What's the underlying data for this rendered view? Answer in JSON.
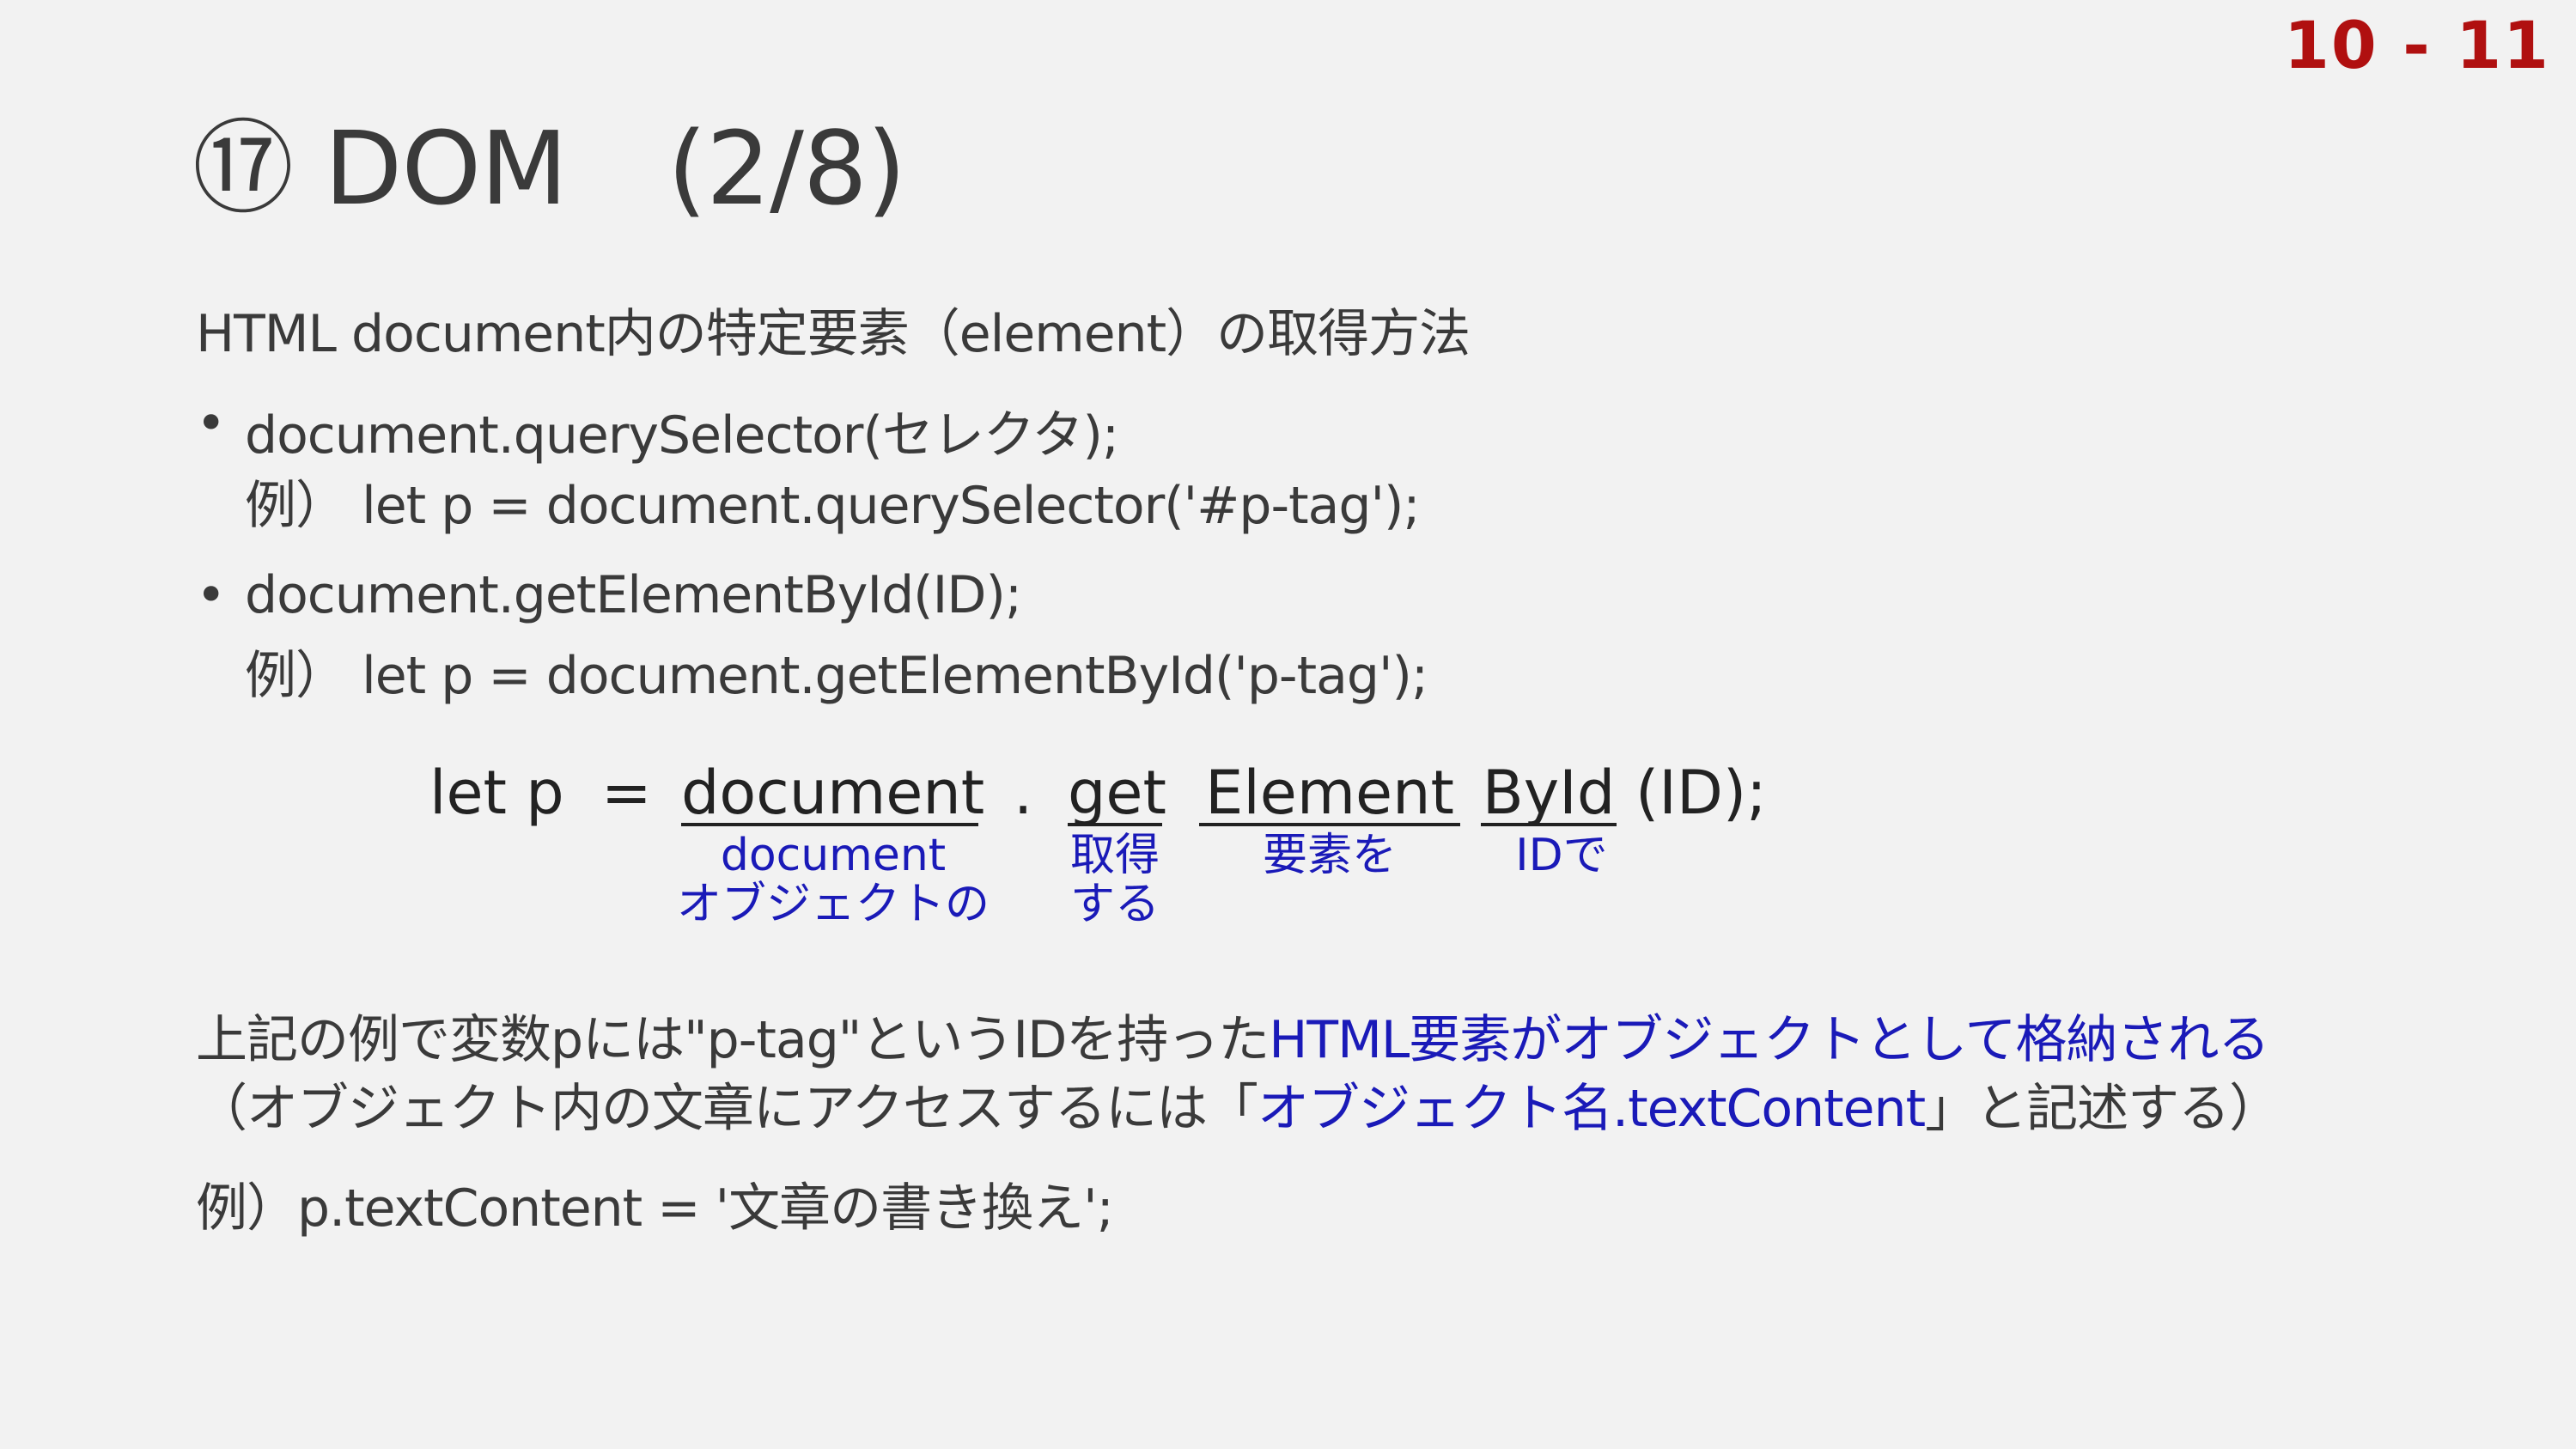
{
  "slide": {
    "page_number": "10 - 11",
    "title": "⑰ DOM　(2/8)",
    "intro": "HTML document内の特定要素（element）の取得方法",
    "bullet_symbol": "•",
    "items": [
      {
        "code": "document.querySelector(セレクタ);",
        "example": "例） let p = document.querySelector('#p-tag');"
      },
      {
        "code": "document.getElementById(ID);",
        "example": "例） let p = document.getElementById('p-tag');"
      }
    ],
    "diagram": {
      "prefix": "let p",
      "equals": "=",
      "dot": ".",
      "suffix": "(ID);",
      "parts": [
        {
          "word": "document",
          "annotation_line1": "document",
          "annotation_line2": "オブジェクトの"
        },
        {
          "word": "get",
          "annotation_line1": "取得",
          "annotation_line2": "する"
        },
        {
          "word": "Element",
          "annotation_line1": "要素を",
          "annotation_line2": ""
        },
        {
          "word": "ById",
          "annotation_line1": "IDで",
          "annotation_line2": ""
        }
      ]
    },
    "explanation": {
      "line1_plain": "上記の例で変数pには\"p-tag\"というIDを持った",
      "line1_highlight": "HTML要素がオブジェクトとして格納される",
      "line2_before": "（オブジェクト内の文章にアクセスするには「",
      "line2_highlight": "オブジェクト名.textContent",
      "line2_after": "」と記述する）"
    },
    "final_example": "例）p.textContent = '文章の書き換え';"
  },
  "colors": {
    "background": "#f2f2f2",
    "text": "#3a3a3a",
    "accent_blue": "#1a1ab8",
    "page_number_red": "#b01010"
  }
}
